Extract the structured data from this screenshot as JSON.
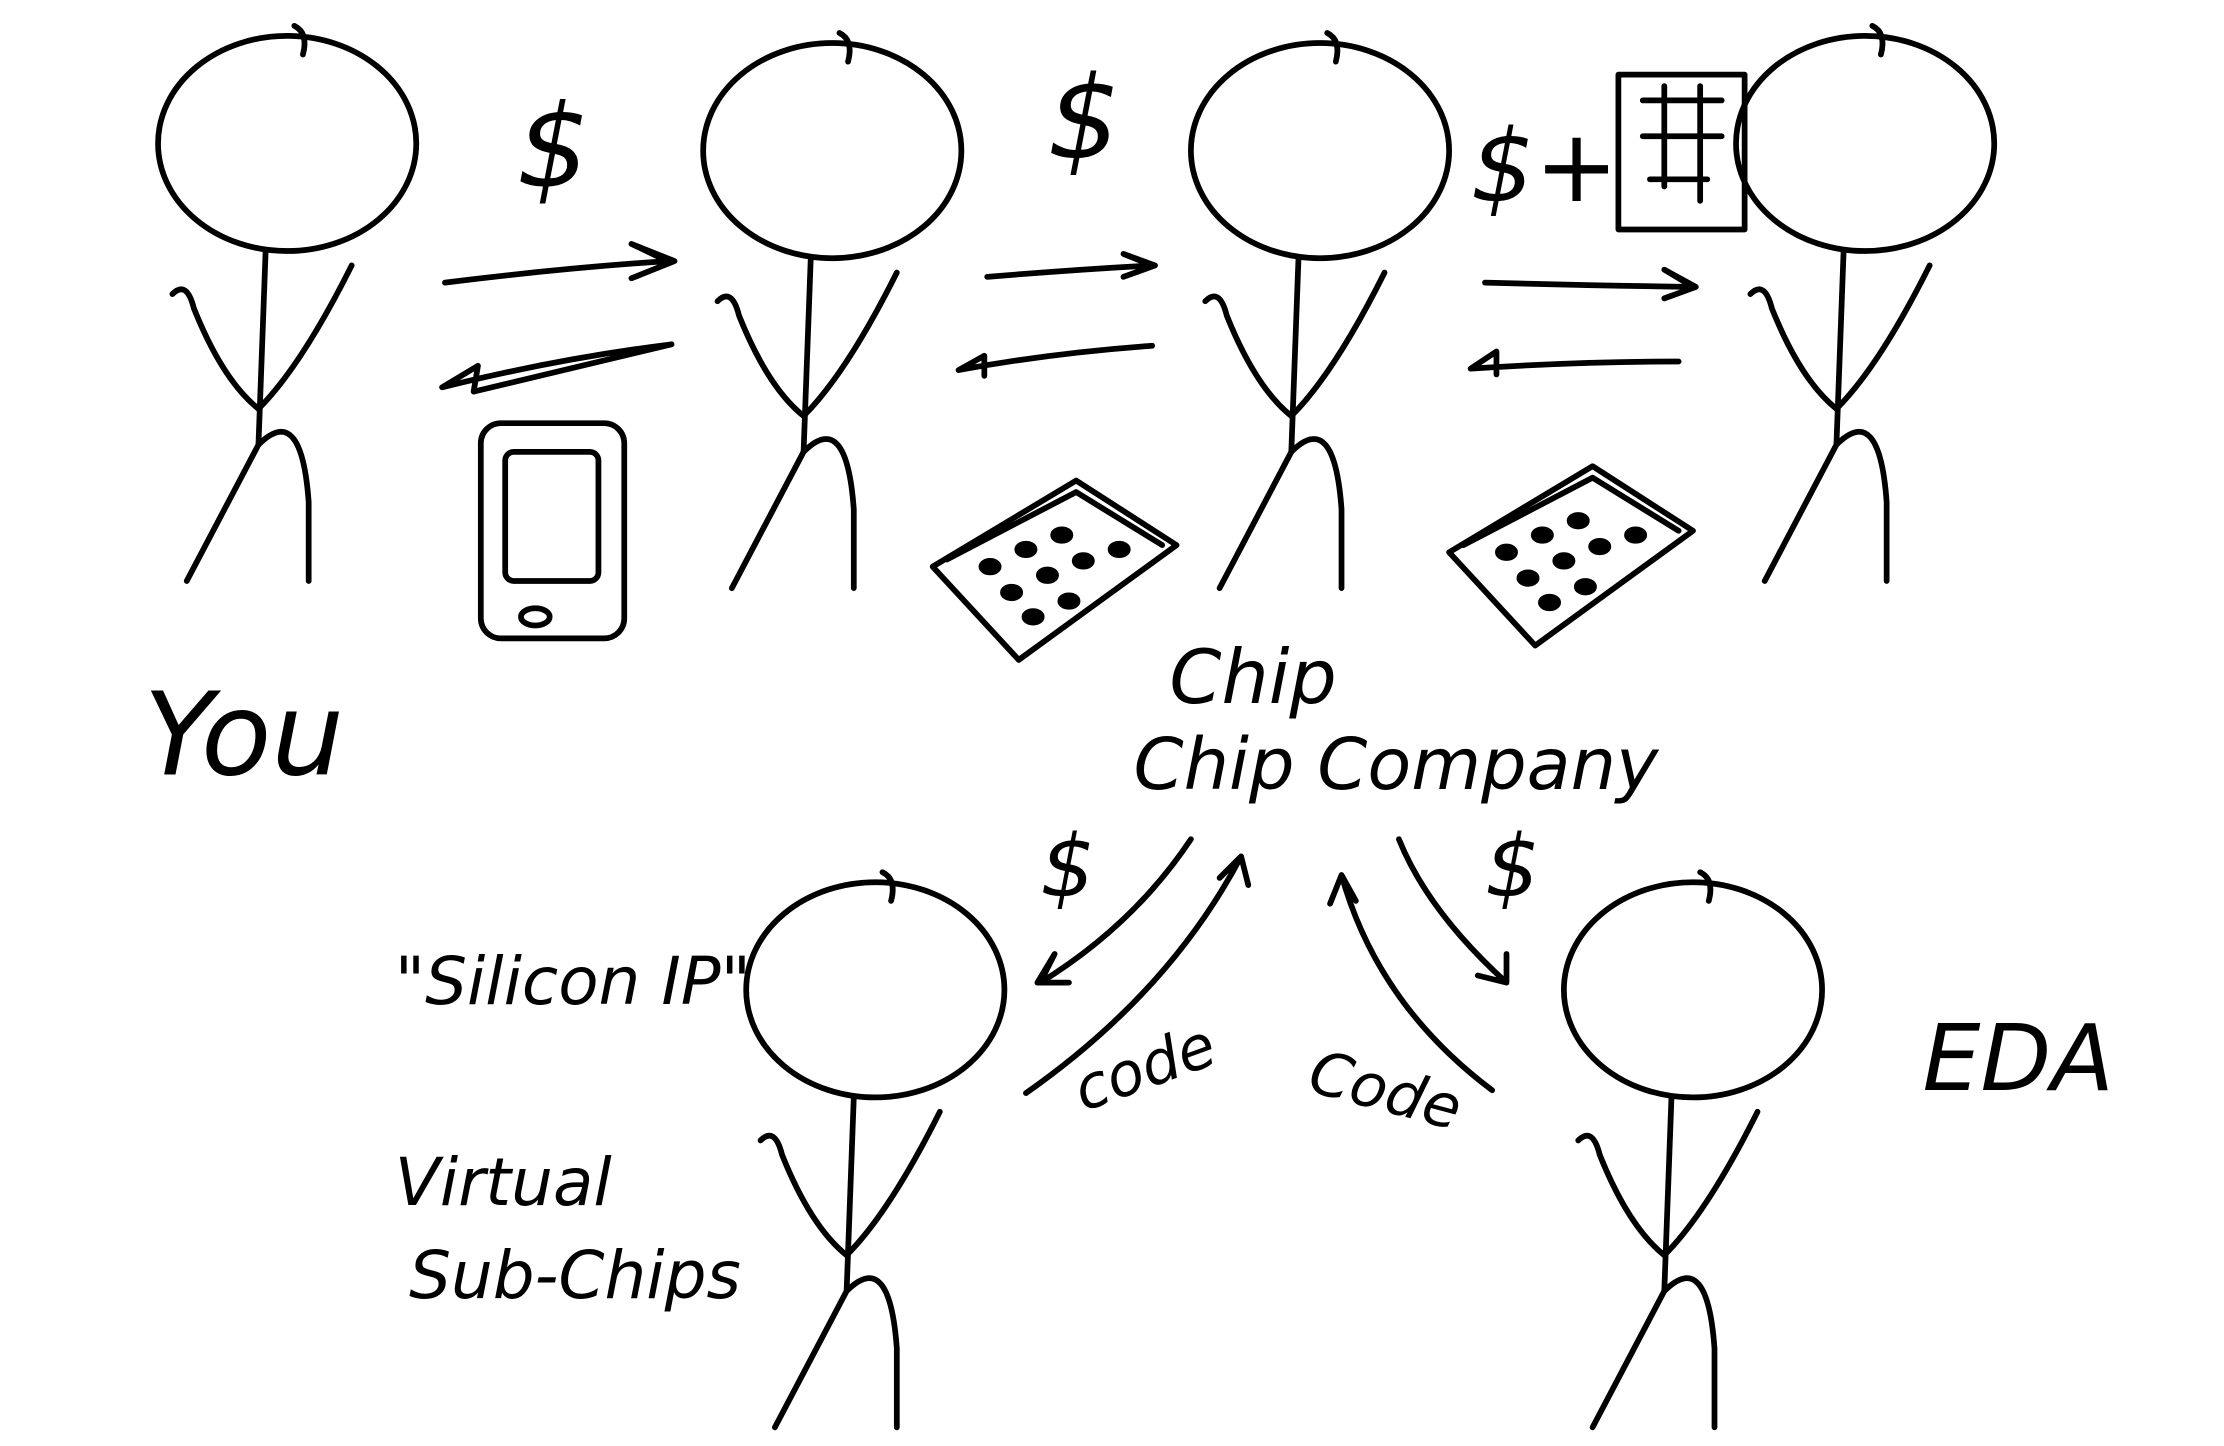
{
  "diagram": {
    "labels": {
      "you": "You",
      "chip_company": "Chip Company",
      "silicon_ip": "\"Silicon IP\"",
      "virtual_sub_chips_1": "Virtual",
      "virtual_sub_chips_2": "Sub-Chips",
      "eda": "EDA"
    },
    "exchanges": {
      "you_to_retailer": "$",
      "retailer_to_oem": "$",
      "oem_to_chip_company": "$+",
      "ip_money": "$",
      "eda_money": "$",
      "ip_code": "code",
      "eda_code": "Code"
    },
    "items": [
      "phone-icon",
      "chip-icon",
      "chip-icon",
      "chip-layout-icon"
    ],
    "ink_color": "#000000",
    "background_color": "#ffffff"
  }
}
